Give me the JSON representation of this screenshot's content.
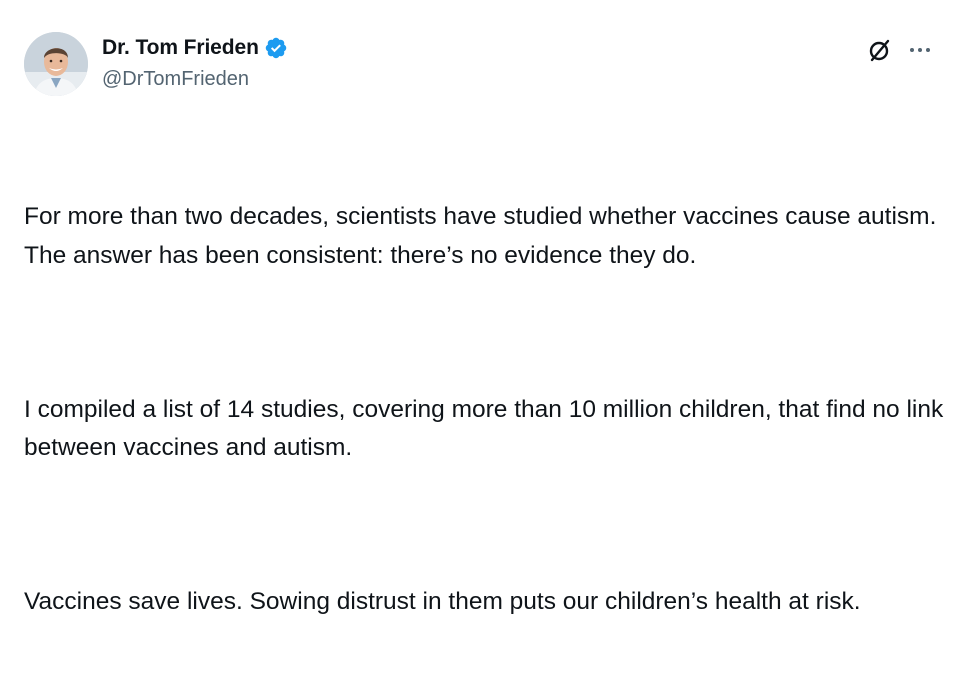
{
  "author": {
    "display_name": "Dr. Tom Frieden",
    "handle": "@DrTomFrieden",
    "verified": true,
    "verified_icon": "verified-badge-icon",
    "avatar_icon": "profile-photo"
  },
  "actions": {
    "grok_icon": "grok-slash-circle-icon",
    "more_icon": "more-options-icon"
  },
  "tweet": {
    "paragraphs": [
      "For more than two decades, scientists have studied whether vaccines cause autism. The answer has been consistent: there’s no evidence they do.",
      "I compiled a list of 14 studies, covering more than 10 million children, that find no link between vaccines and autism.",
      "Vaccines save lives. Sowing distrust in them puts our children’s health at risk."
    ]
  },
  "colors": {
    "text_primary": "#0f1419",
    "text_secondary": "#536471",
    "verified_blue": "#1d9bf0",
    "background": "#ffffff"
  }
}
